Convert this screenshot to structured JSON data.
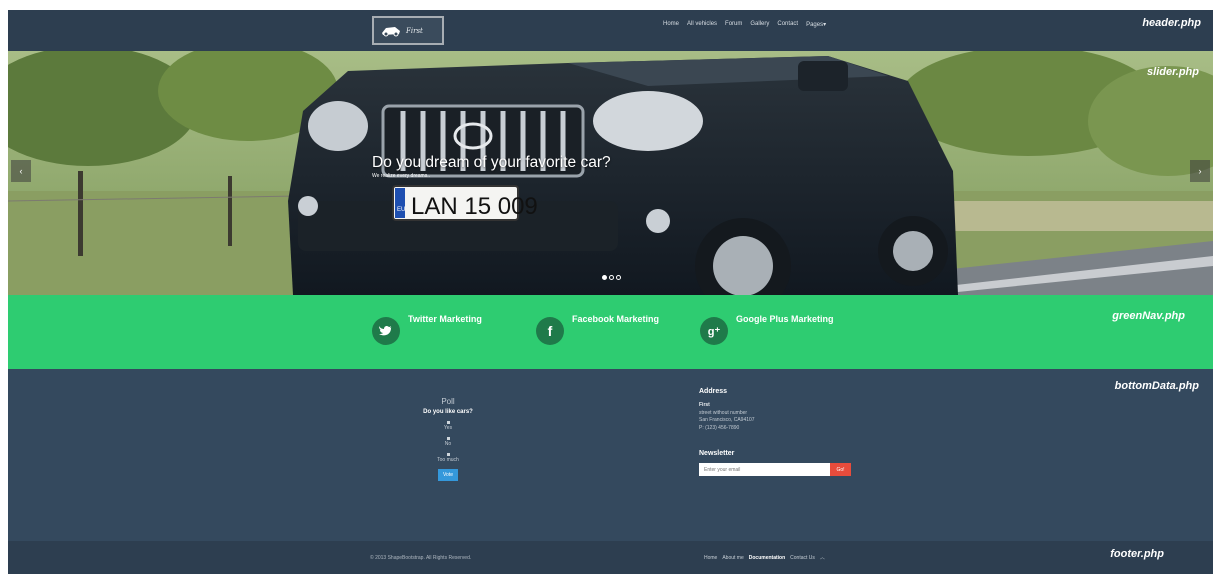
{
  "header": {
    "logo_text": "First",
    "nav": [
      "Home",
      "All vehicles",
      "Forum",
      "Gallery",
      "Contact",
      "Pages▾"
    ],
    "label": "header.php"
  },
  "slider": {
    "title": "Do you dream of your favorite car?",
    "subtitle": "We realize every dreams..",
    "plate": "LAN 15 009",
    "plate_country": "EU",
    "label": "slider.php",
    "prev_icon": "‹",
    "next_icon": "›",
    "dot_count": 3,
    "active_dot": 1
  },
  "green_nav": {
    "label": "greenNav.php",
    "items": [
      {
        "icon": "twitter-icon",
        "glyph": "t",
        "text": "Twitter Marketing"
      },
      {
        "icon": "facebook-icon",
        "glyph": "f",
        "text": "Facebook Marketing"
      },
      {
        "icon": "google-plus-icon",
        "glyph": "g+",
        "text": "Google Plus Marketing"
      }
    ]
  },
  "bottom": {
    "label": "bottomData.php",
    "poll": {
      "title": "Poll",
      "question": "Do you like cars?",
      "options": [
        "Yes",
        "No",
        "Too much"
      ],
      "vote_label": "Vote"
    },
    "address": {
      "heading": "Address",
      "name": "First",
      "line1": "street without number",
      "line2": "San Francisco, CA94107",
      "phone": "P: (123) 456-7890"
    },
    "newsletter": {
      "heading": "Newsletter",
      "placeholder": "Enter your email",
      "button": "Go!"
    }
  },
  "footer": {
    "label": "footer.php",
    "copyright": "© 2013 ShapeBootstrap. All Rights Reserved.",
    "links": [
      "Home",
      "About me",
      "Documentation",
      "Contact Us"
    ],
    "up_icon": "︿"
  },
  "colors": {
    "header_bg": "#2d3e50",
    "green": "#2ecc71",
    "bottom_bg": "#34495e",
    "vote": "#3498db",
    "go": "#e74c3c"
  }
}
